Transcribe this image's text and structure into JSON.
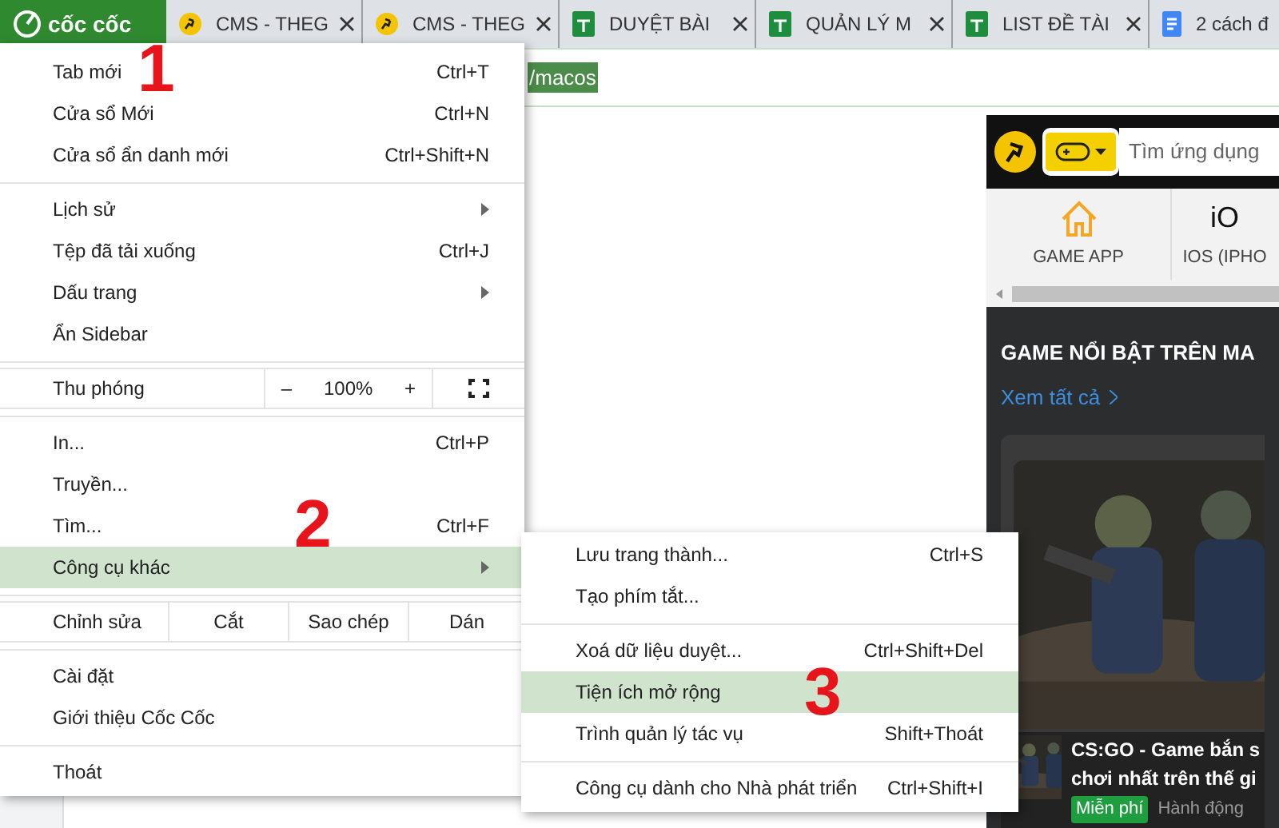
{
  "browser": {
    "logo": "cốc cốc",
    "tabs": [
      {
        "title": "CMS - THEG",
        "kind": "runner"
      },
      {
        "title": "CMS - THEG",
        "kind": "runner"
      },
      {
        "title": "DUYỆT BÀI",
        "kind": "sheet"
      },
      {
        "title": "QUẢN LÝ M",
        "kind": "sheet"
      },
      {
        "title": "LIST ĐỀ TÀI",
        "kind": "sheet"
      },
      {
        "title": "2 cách đ",
        "kind": "doc"
      }
    ],
    "address": {
      "text": "/macos",
      "selected": true
    }
  },
  "menu": {
    "items": [
      {
        "kind": "item",
        "label": "Tab mới",
        "shortcut": "Ctrl+T",
        "selected": false
      },
      {
        "kind": "item",
        "label": "Cửa sổ Mới",
        "shortcut": "Ctrl+N",
        "selected": false
      },
      {
        "kind": "item",
        "label": "Cửa sổ ẩn danh mới",
        "shortcut": "Ctrl+Shift+N",
        "selected": false
      },
      {
        "kind": "separator"
      },
      {
        "kind": "item",
        "label": "Lịch sử",
        "submenu": true,
        "selected": false
      },
      {
        "kind": "item",
        "label": "Tệp đã tải xuống",
        "shortcut": "Ctrl+J",
        "selected": false
      },
      {
        "kind": "item",
        "label": "Dấu trang",
        "submenu": true,
        "selected": false
      },
      {
        "kind": "item",
        "label": "Ẩn Sidebar",
        "selected": false
      },
      {
        "kind": "separator"
      },
      {
        "kind": "zoom",
        "label": "Thu phóng",
        "minus": "–",
        "value": "100%",
        "plus": "+"
      },
      {
        "kind": "separator"
      },
      {
        "kind": "item",
        "label": "In...",
        "shortcut": "Ctrl+P",
        "selected": false
      },
      {
        "kind": "item",
        "label": "Truyền...",
        "selected": false
      },
      {
        "kind": "item",
        "label": "Tìm...",
        "shortcut": "Ctrl+F",
        "selected": false
      },
      {
        "kind": "item",
        "label": "Công cụ khác",
        "submenu": true,
        "selected": true
      },
      {
        "kind": "separator"
      },
      {
        "kind": "edit",
        "label": "Chỉnh sửa",
        "buttons": [
          "Cắt",
          "Sao chép",
          "Dán"
        ]
      },
      {
        "kind": "separator"
      },
      {
        "kind": "item",
        "label": "Cài đặt",
        "selected": false
      },
      {
        "kind": "item",
        "label": "Giới thiệu Cốc Cốc",
        "selected": false
      },
      {
        "kind": "separator"
      },
      {
        "kind": "item",
        "label": "Thoát",
        "selected": false
      }
    ]
  },
  "submenu": {
    "items": [
      {
        "kind": "item",
        "label": "Lưu trang thành...",
        "shortcut": "Ctrl+S",
        "selected": false
      },
      {
        "kind": "item",
        "label": "Tạo phím tắt...",
        "selected": false
      },
      {
        "kind": "separator"
      },
      {
        "kind": "item",
        "label": "Xoá dữ liệu duyệt...",
        "shortcut": "Ctrl+Shift+Del",
        "selected": false
      },
      {
        "kind": "item",
        "label": "Tiện ích mở rộng",
        "selected": true
      },
      {
        "kind": "item",
        "label": "Trình quản lý tác vụ",
        "shortcut": "Shift+Thoát",
        "selected": false
      },
      {
        "kind": "separator"
      },
      {
        "kind": "item",
        "label": "Công cụ dành cho Nhà phát triển",
        "shortcut": "Ctrl+Shift+I",
        "selected": false
      }
    ]
  },
  "annotations": [
    "1",
    "2",
    "3"
  ],
  "panel": {
    "search_placeholder": "Tìm ứng dụng",
    "nav": [
      {
        "kind": "home",
        "label": "GAME APP"
      },
      {
        "kind": "os",
        "heading": "iO",
        "label": "IOS (IPHO"
      }
    ],
    "section_title": "GAME NỔI BẬT TRÊN MA",
    "see_all": "Xem tất cả",
    "game": {
      "title": "CS:GO - Game bắn s\nchơi nhất trên thế gi",
      "price": "Miễn phí",
      "genre": "Hành động"
    }
  }
}
